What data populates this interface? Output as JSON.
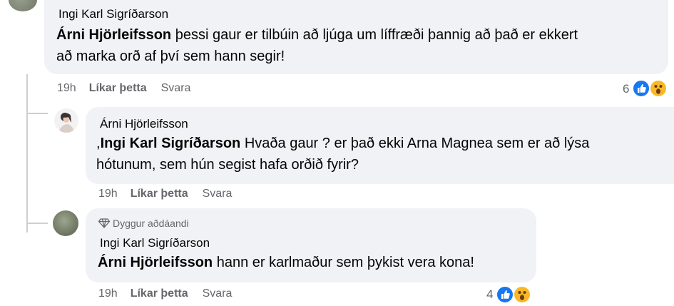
{
  "comments": [
    {
      "author": "Ingi Karl Sigríðarson",
      "mention": "Árni Hjörleifsson",
      "text_line1": " þessi gaur er tilbúin að ljúga um líffræði þannig að það er ekkert",
      "text_line2": "að marka orð af því sem hann segir!",
      "time": "19h",
      "like_label": "Líkar þetta",
      "reply_label": "Svara",
      "reaction_count": "6"
    },
    {
      "author": "Árni Hjörleifsson",
      "mention_prefix": ",",
      "mention": "Ingi Karl Sigríðarson",
      "text_line1": " Hvaða gaur ? er það ekki Arna Magnea sem er að lýsa",
      "text_line2": "hótunum, sem hún segist hafa orðið fyrir?",
      "time": "19h",
      "like_label": "Líkar þetta",
      "reply_label": "Svara"
    },
    {
      "badge": "Dyggur aðdáandi",
      "author": "Ingi Karl Sigríðarson",
      "mention": "Árni Hjörleifsson",
      "text_line1": " hann er karlmaður sem þykist vera kona!",
      "time": "19h",
      "like_label": "Líkar þetta",
      "reply_label": "Svara",
      "reaction_count": "4"
    }
  ],
  "icons": {
    "like": "like-icon",
    "wow": "wow-icon",
    "badge": "diamond-badge-icon"
  },
  "colors": {
    "bubble": "#f0f2f5",
    "meta": "#65676b",
    "like_blue": "#1877f2",
    "wow_yellow": "#f7b928"
  }
}
